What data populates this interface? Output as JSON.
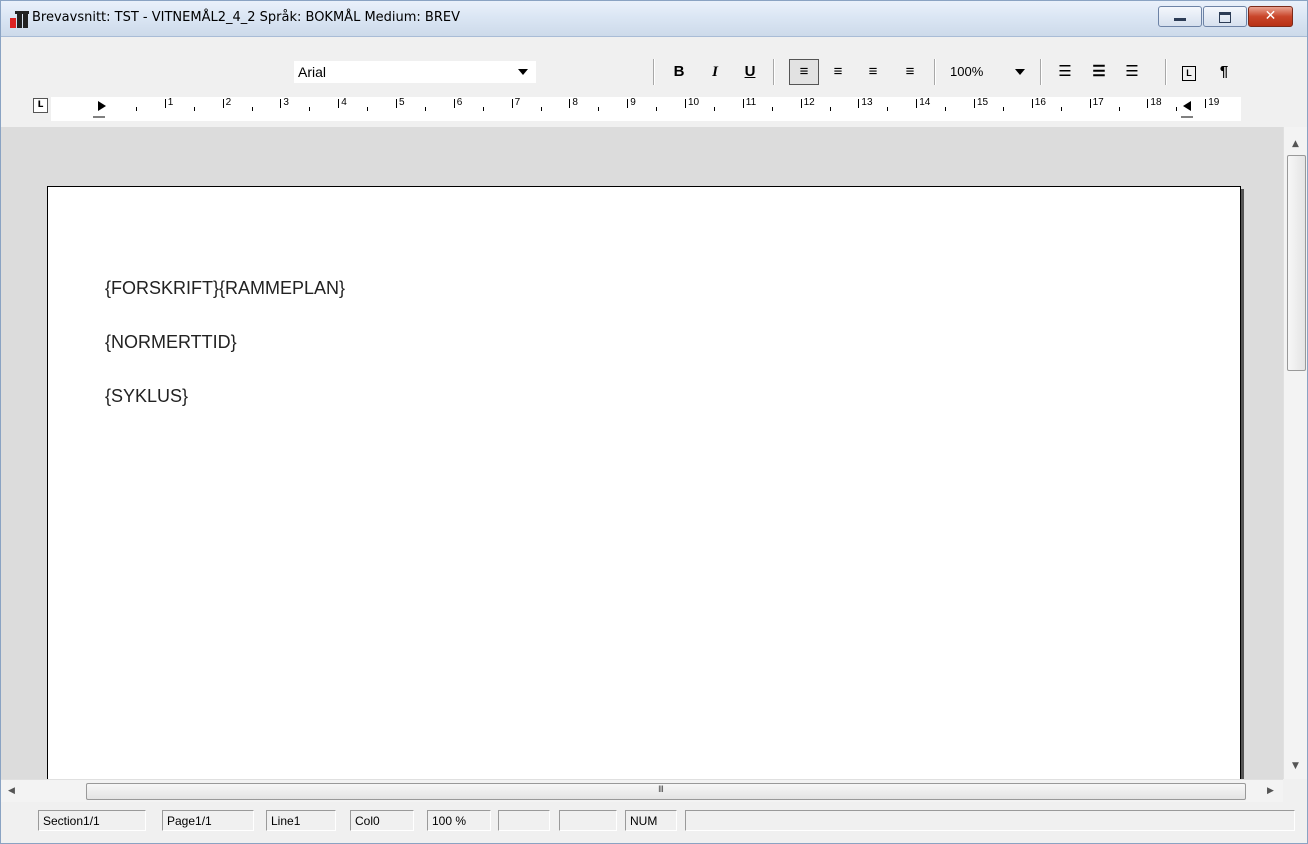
{
  "window": {
    "title": "Brevavsnitt: TST - VITNEMÅL2_4_2 Språk: BOKMÅL Medium: BREV",
    "close_glyph": "✕"
  },
  "toolbar": {
    "font": "Arial",
    "bold": "B",
    "italic": "I",
    "underline": "U",
    "align_left": "≡",
    "align_right": "≡",
    "align_center": "≡",
    "justify": "≡",
    "zoom": "100%",
    "numbered_list": "☰",
    "bullet_list": "☰",
    "outline_list": "☰",
    "tabstop": "L",
    "pilcrow": "¶"
  },
  "ruler": {
    "tab_type": "L",
    "numbers": [
      "1",
      "2",
      "3",
      "4",
      "5",
      "6",
      "7",
      "8",
      "9",
      "10",
      "11",
      "12",
      "13",
      "14",
      "15",
      "16",
      "17",
      "18",
      "19"
    ]
  },
  "document": {
    "lines": [
      "{FORSKRIFT}{RAMMEPLAN}",
      "{NORMERTTID}",
      "{SYKLUS}"
    ]
  },
  "scroll": {
    "up": "▲",
    "down": "▼",
    "left": "◀",
    "right": "▶",
    "grip": "III"
  },
  "status": {
    "section": "Section1/1",
    "page": "Page1/1",
    "line": "Line1",
    "col": "Col0",
    "zoom": "100 %",
    "empty1": "",
    "empty2": "",
    "num": "NUM",
    "empty3": ""
  }
}
